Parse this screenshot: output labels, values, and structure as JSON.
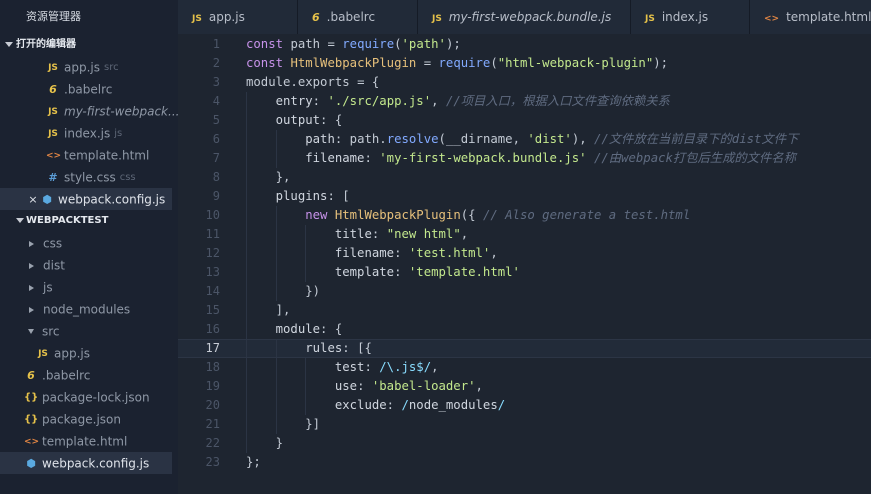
{
  "sidebar": {
    "title": "资源管理器",
    "open_editors": {
      "label": "打开的编辑器",
      "items": [
        {
          "icon": "JS",
          "name": "app.js",
          "hint": "src"
        },
        {
          "icon": "6",
          "name": ".babelrc",
          "hint": ""
        },
        {
          "icon": "JS",
          "name": "my-first-webpack....",
          "hint": ""
        },
        {
          "icon": "JS",
          "name": "index.js",
          "hint": "js"
        },
        {
          "icon": "<>",
          "name": "template.html",
          "hint": ""
        },
        {
          "icon": "#",
          "name": "style.css",
          "hint": "css"
        },
        {
          "icon": "cube",
          "name": "webpack.config.js",
          "hint": "",
          "close": "×"
        }
      ]
    },
    "project": {
      "label": "WEBPACKTEST",
      "items": [
        {
          "name": "css"
        },
        {
          "name": "dist"
        },
        {
          "name": "js"
        },
        {
          "name": "node_modules"
        },
        {
          "name": "src"
        },
        {
          "name": "app.js",
          "icon": "JS"
        },
        {
          "name": ".babelrc",
          "icon": "6"
        },
        {
          "name": "package-lock.json",
          "icon": "{}"
        },
        {
          "name": "package.json",
          "icon": "{}"
        },
        {
          "name": "template.html",
          "icon": "<>"
        },
        {
          "name": "webpack.config.js",
          "icon": "cube"
        }
      ]
    }
  },
  "tabs": [
    {
      "icon": "JS",
      "label": "app.js"
    },
    {
      "icon": "6",
      "label": ".babelrc"
    },
    {
      "icon": "JS",
      "label": "my-first-webpack.bundle.js"
    },
    {
      "icon": "JS",
      "label": "index.js"
    },
    {
      "icon": "<>",
      "label": "template.html"
    }
  ],
  "editor": {
    "current_line": 17,
    "lines": [
      "const path = require('path');",
      "const HtmlWebpackPlugin = require(\"html-webpack-plugin\");",
      "module.exports = {",
      "    entry: './src/app.js', //项目入口，根据入口文件查询依赖关系",
      "    output: {",
      "        path: path.resolve(__dirname, 'dist'), //文件放在当前目录下的dist文件下",
      "        filename: 'my-first-webpack.bundle.js' //由webpack打包后生成的文件名称",
      "    },",
      "    plugins: [",
      "        new HtmlWebpackPlugin({ // Also generate a test.html",
      "            title: \"new html\",",
      "            filename: 'test.html',",
      "            template: 'template.html'",
      "        })",
      "    ],",
      "    module: {",
      "        rules: [{",
      "            test: /\\.js$/,",
      "            use: 'babel-loader',",
      "            exclude: /node_modules/",
      "        }]",
      "    }",
      "};"
    ]
  },
  "colors": {
    "background": "#1e2530",
    "sidebar": "#1b2230",
    "keyword": "#c792ea",
    "string": "#c3e88d",
    "function": "#82aaff",
    "class": "#e6c07b",
    "comment": "#5f6b80",
    "js_icon": "#e6c24a",
    "html_icon": "#e08544"
  }
}
